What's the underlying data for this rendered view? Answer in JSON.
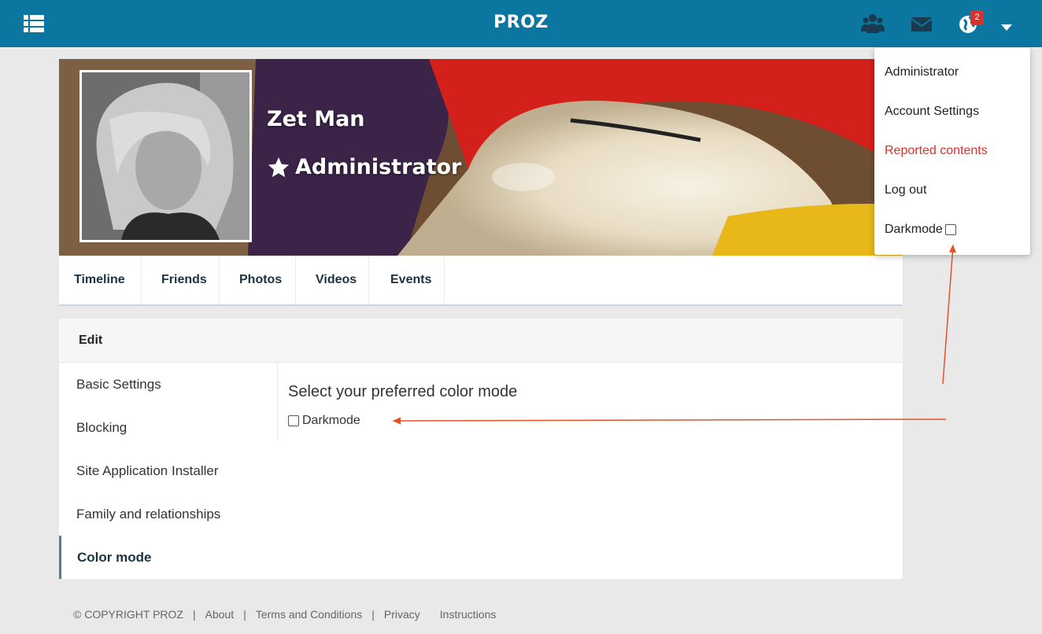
{
  "app": {
    "brand": "PROZ",
    "notification_count": "2"
  },
  "profile": {
    "name": "Zet Man",
    "role": "Administrator"
  },
  "tabs": [
    {
      "label": "Timeline"
    },
    {
      "label": "Friends"
    },
    {
      "label": "Photos"
    },
    {
      "label": "Videos"
    },
    {
      "label": "Events"
    }
  ],
  "settings": {
    "header": "Edit",
    "nav": [
      {
        "label": "Basic Settings"
      },
      {
        "label": "Blocking"
      },
      {
        "label": "Site Application Installer"
      },
      {
        "label": "Family and relationships"
      },
      {
        "label": "Color mode",
        "active": true
      }
    ],
    "content": {
      "title": "Select your preferred color mode",
      "checkbox_label": "Darkmode",
      "checked": false
    }
  },
  "dropdown": {
    "items": [
      {
        "label": "Administrator"
      },
      {
        "label": "Account Settings"
      },
      {
        "label": "Reported contents",
        "color": "#d9322b"
      },
      {
        "label": "Log out"
      },
      {
        "label": "Darkmode",
        "checkbox": true
      }
    ]
  },
  "footer": {
    "copyright": "© COPYRIGHT PROZ",
    "links": [
      {
        "label": "About"
      },
      {
        "label": "Terms and Conditions"
      },
      {
        "label": "Privacy"
      },
      {
        "label": "Instructions"
      }
    ]
  },
  "colors": {
    "topbar": "#0b76a0",
    "accent_red": "#d9322b",
    "annotation_arrow": "#e4522a"
  },
  "icons": [
    "list-menu-icon",
    "users-icon",
    "envelope-icon",
    "globe-notification-icon",
    "caret-down-icon",
    "star-icon"
  ]
}
